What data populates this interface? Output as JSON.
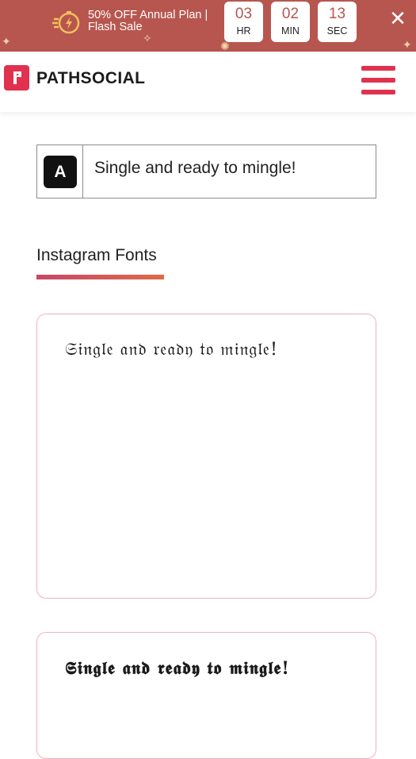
{
  "promo": {
    "line1": "50% OFF Annual Plan |",
    "line2": "Flash Sale",
    "timer": [
      {
        "value": "03",
        "unit": "HR"
      },
      {
        "value": "02",
        "unit": "MIN"
      },
      {
        "value": "13",
        "unit": "SEC"
      }
    ],
    "close_icon": "✕"
  },
  "header": {
    "logo_text": "PATHSOCIAL"
  },
  "input": {
    "badge": "A",
    "value": "Single and ready to mingle!"
  },
  "section": {
    "title": "Instagram Fonts"
  },
  "cards": [
    {
      "text": "𝔖𝔦𝔫𝔤𝔩𝔢 𝔞𝔫𝔡 𝔯𝔢𝔞𝔡𝔶 𝔱𝔬 𝔪𝔦𝔫𝔤𝔩𝔢!"
    },
    {
      "text": "𝕾𝖎𝖓𝖌𝖑𝖊 𝖆𝖓𝖉 𝖗𝖊𝖆𝖉𝖞 𝖙𝖔 𝖒𝖎𝖓𝖌𝖑𝖊!"
    }
  ],
  "colors": {
    "promo_bg": "#b7564f",
    "brand_red": "#e0324e",
    "card_border": "#efb1c0"
  }
}
